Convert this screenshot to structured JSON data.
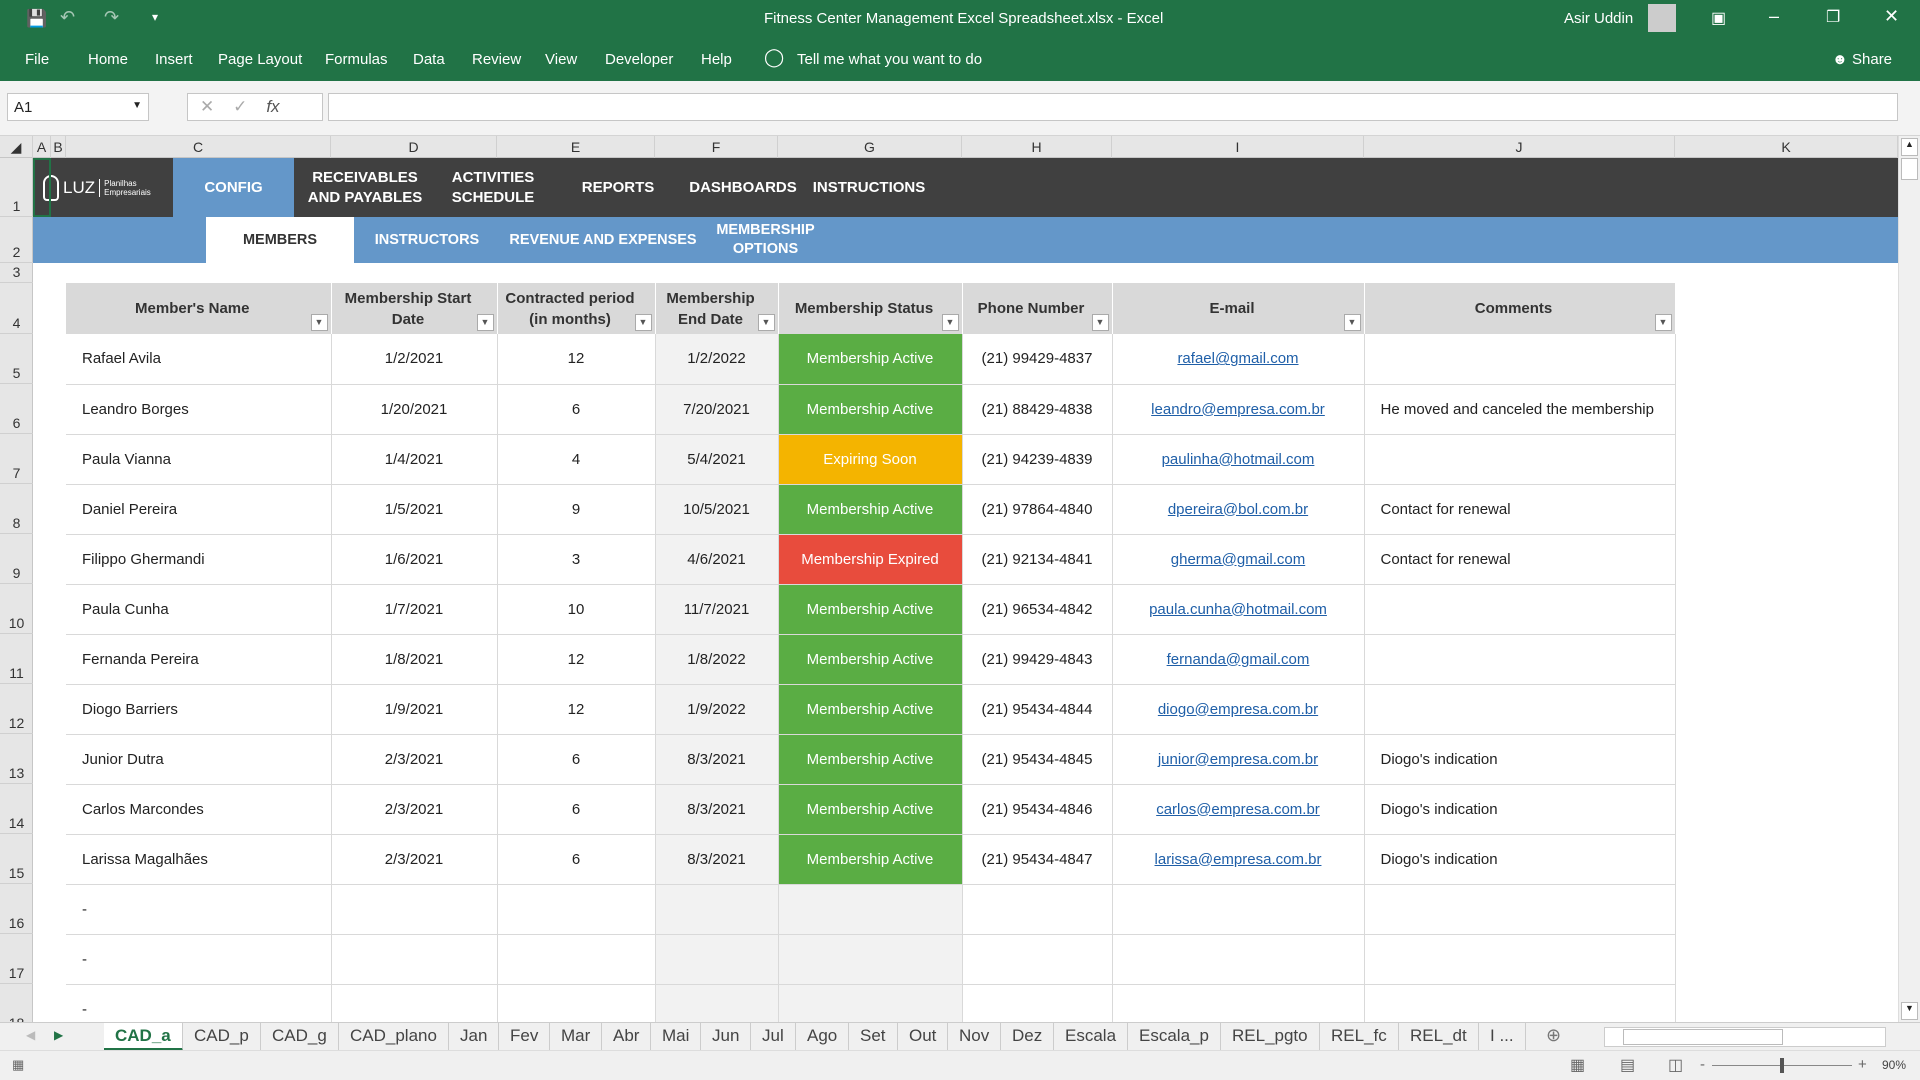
{
  "window": {
    "title": "Fitness Center Management Excel Spreadsheet.xlsx  -  Excel",
    "user": "Asir Uddin"
  },
  "ribbon": {
    "tabs": [
      "File",
      "Home",
      "Insert",
      "Page Layout",
      "Formulas",
      "Data",
      "Review",
      "View",
      "Developer",
      "Help"
    ],
    "tell_me": "Tell me what you want to do",
    "share": "Share"
  },
  "formula_bar": {
    "name_box": "A1",
    "fx": "fx",
    "formula": ""
  },
  "columns": [
    "A",
    "B",
    "C",
    "D",
    "E",
    "F",
    "G",
    "H",
    "I",
    "J",
    "K"
  ],
  "rows": [
    "1",
    "2",
    "3",
    "4",
    "5",
    "6",
    "7",
    "8",
    "9",
    "10",
    "11",
    "12",
    "13",
    "14",
    "15",
    "16",
    "17",
    "18"
  ],
  "logo": {
    "text": "LUZ",
    "sub": "Planilhas Empresariais"
  },
  "nav": {
    "main": [
      "CONFIG",
      "RECEIVABLES AND PAYABLES",
      "ACTIVITIES SCHEDULE",
      "REPORTS",
      "DASHBOARDS",
      "INSTRUCTIONS"
    ],
    "active_main": "CONFIG",
    "sub": [
      "MEMBERS",
      "INSTRUCTORS",
      "REVENUE AND EXPENSES",
      "MEMBERSHIP OPTIONS"
    ],
    "active_sub": "MEMBERS"
  },
  "table": {
    "headers": [
      "Member's Name",
      "Membership Start Date",
      "Contracted period (in months)",
      "Membership End Date",
      "Membership Status",
      "Phone Number",
      "E-mail",
      "Comments"
    ],
    "rows": [
      [
        "Rafael Avila",
        "1/2/2021",
        "12",
        "1/2/2022",
        "Membership Active",
        "(21) 99429-4837",
        "rafael@gmail.com",
        ""
      ],
      [
        "Leandro Borges",
        "1/20/2021",
        "6",
        "7/20/2021",
        "Membership Active",
        "(21) 88429-4838",
        "leandro@empresa.com.br",
        "He moved and canceled the membership"
      ],
      [
        "Paula Vianna",
        "1/4/2021",
        "4",
        "5/4/2021",
        "Expiring Soon",
        "(21) 94239-4839",
        "paulinha@hotmail.com",
        ""
      ],
      [
        "Daniel Pereira",
        "1/5/2021",
        "9",
        "10/5/2021",
        "Membership Active",
        "(21) 97864-4840",
        "dpereira@bol.com.br",
        "Contact for renewal"
      ],
      [
        "Filippo Ghermandi",
        "1/6/2021",
        "3",
        "4/6/2021",
        "Membership Expired",
        "(21) 92134-4841",
        "gherma@gmail.com",
        "Contact for renewal"
      ],
      [
        "Paula Cunha",
        "1/7/2021",
        "10",
        "11/7/2021",
        "Membership Active",
        "(21) 96534-4842",
        "paula.cunha@hotmail.com",
        ""
      ],
      [
        "Fernanda Pereira",
        "1/8/2021",
        "12",
        "1/8/2022",
        "Membership Active",
        "(21) 99429-4843",
        "fernanda@gmail.com",
        ""
      ],
      [
        "Diogo Barriers",
        "1/9/2021",
        "12",
        "1/9/2022",
        "Membership Active",
        "(21) 95434-4844",
        "diogo@empresa.com.br",
        ""
      ],
      [
        "Junior Dutra",
        "2/3/2021",
        "6",
        "8/3/2021",
        "Membership Active",
        "(21) 95434-4845",
        "junior@empresa.com.br",
        "Diogo's indication"
      ],
      [
        "Carlos Marcondes",
        "2/3/2021",
        "6",
        "8/3/2021",
        "Membership Active",
        "(21) 95434-4846",
        "carlos@empresa.com.br",
        "Diogo's indication"
      ],
      [
        "Larissa Magalhães",
        "2/3/2021",
        "6",
        "8/3/2021",
        "Membership Active",
        "(21) 95434-4847",
        "larissa@empresa.com.br",
        "Diogo's indication"
      ],
      [
        "-",
        "",
        "",
        "",
        "",
        "",
        "",
        ""
      ],
      [
        "-",
        "",
        "",
        "",
        "",
        "",
        "",
        ""
      ],
      [
        "-",
        "",
        "",
        "",
        "",
        "",
        "",
        ""
      ]
    ]
  },
  "status_colors": {
    "Membership Active": "#5aad44",
    "Expiring Soon": "#f4b400",
    "Membership Expired": "#e84c3d"
  },
  "sheet_tabs": [
    "CAD_a",
    "CAD_p",
    "CAD_g",
    "CAD_plano",
    "Jan",
    "Fev",
    "Mar",
    "Abr",
    "Mai",
    "Jun",
    "Jul",
    "Ago",
    "Set",
    "Out",
    "Nov",
    "Dez",
    "Escala",
    "Escala_p",
    "REL_pgto",
    "REL_fc",
    "REL_dt",
    "I ..."
  ],
  "active_sheet": "CAD_a",
  "zoom": "90%"
}
